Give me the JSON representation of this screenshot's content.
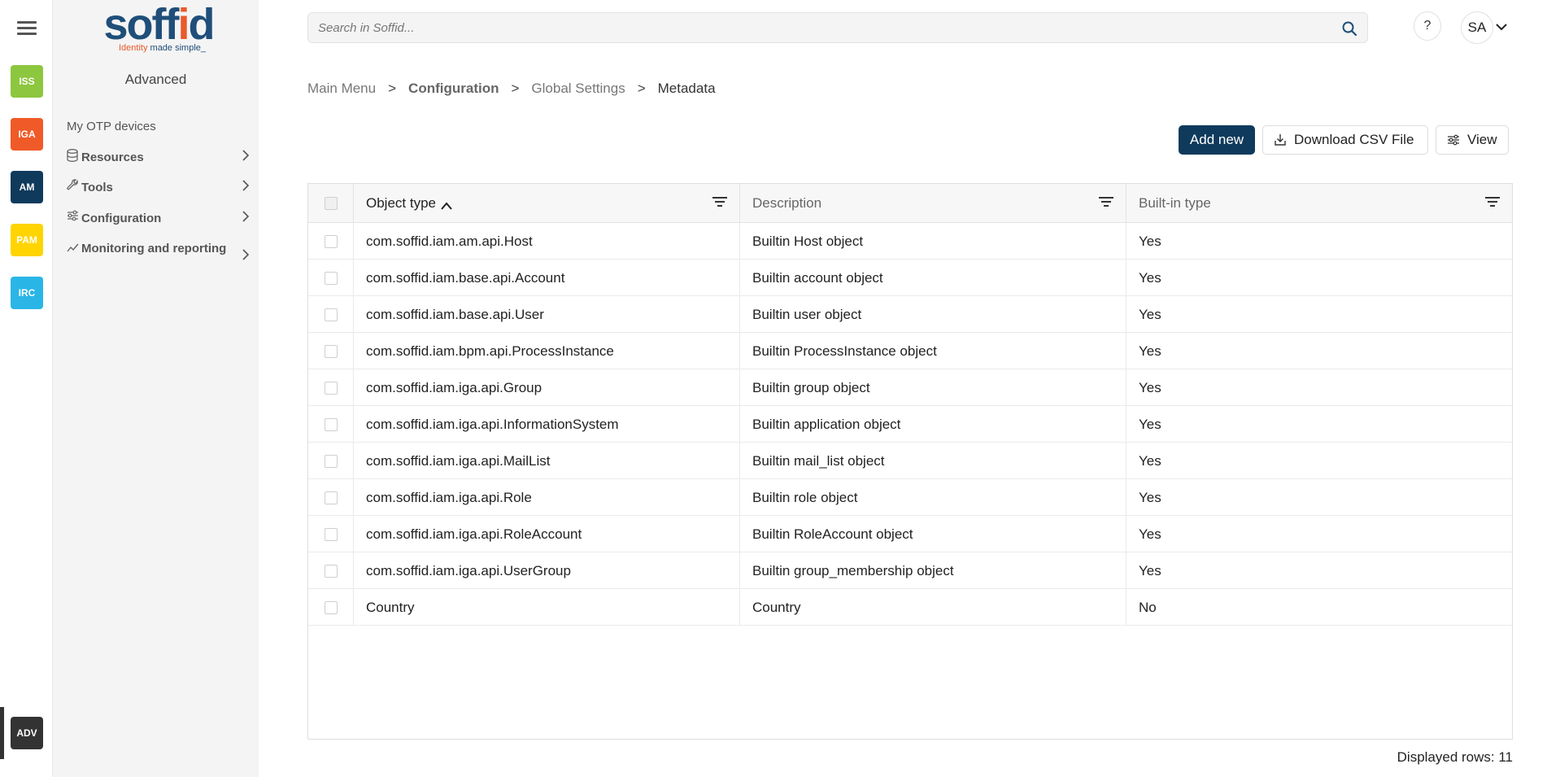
{
  "apps": [
    {
      "label": "ISS",
      "color": "#8dc63f"
    },
    {
      "label": "IGA",
      "color": "#f05a28"
    },
    {
      "label": "AM",
      "color": "#0f3a5c"
    },
    {
      "label": "PAM",
      "color": "#ffd400"
    },
    {
      "label": "IRC",
      "color": "#29b6e6"
    },
    {
      "label": "ADV",
      "color": "#333333"
    }
  ],
  "logo": {
    "brand": "soffid",
    "tagline_colored": "Identity ",
    "tagline_dark": "made simple_"
  },
  "sidebar": {
    "title": "Advanced",
    "items": [
      {
        "label": "My OTP devices"
      },
      {
        "label": "Resources"
      },
      {
        "label": "Tools"
      },
      {
        "label": "Configuration"
      },
      {
        "label": "Monitoring and reporting"
      }
    ]
  },
  "header": {
    "search_placeholder": "Search in Soffid...",
    "help_label": "?",
    "user_initials": "SA"
  },
  "breadcrumb": [
    "Main Menu",
    "Configuration",
    "Global Settings",
    "Metadata"
  ],
  "toolbar": {
    "add_label": "Add new",
    "csv_label": "Download CSV File",
    "view_label": "View"
  },
  "table": {
    "columns": [
      "Object type",
      "Description",
      "Built-in type"
    ],
    "rows": [
      [
        "com.soffid.iam.am.api.Host",
        "Builtin Host object",
        "Yes"
      ],
      [
        "com.soffid.iam.base.api.Account",
        "Builtin account object",
        "Yes"
      ],
      [
        "com.soffid.iam.base.api.User",
        "Builtin user object",
        "Yes"
      ],
      [
        "com.soffid.iam.bpm.api.ProcessInstance",
        "Builtin ProcessInstance object",
        "Yes"
      ],
      [
        "com.soffid.iam.iga.api.Group",
        "Builtin group object",
        "Yes"
      ],
      [
        "com.soffid.iam.iga.api.InformationSystem",
        "Builtin application object",
        "Yes"
      ],
      [
        "com.soffid.iam.iga.api.MailList",
        "Builtin mail_list object",
        "Yes"
      ],
      [
        "com.soffid.iam.iga.api.Role",
        "Builtin role object",
        "Yes"
      ],
      [
        "com.soffid.iam.iga.api.RoleAccount",
        "Builtin RoleAccount object",
        "Yes"
      ],
      [
        "com.soffid.iam.iga.api.UserGroup",
        "Builtin group_membership object",
        "Yes"
      ],
      [
        "Country",
        "Country",
        "No"
      ]
    ]
  },
  "footer": {
    "displayed_rows": "Displayed rows: 11"
  }
}
